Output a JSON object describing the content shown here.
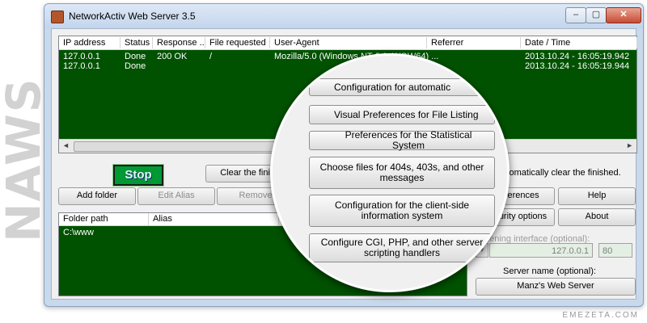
{
  "watermark": "NAWS",
  "credit": "EMEZETA.COM",
  "window": {
    "title": "NetworkActiv Web Server 3.5",
    "controls": {
      "minimize": "–",
      "maximize": "▢",
      "close": "✕"
    }
  },
  "log": {
    "columns": [
      "IP address",
      "Status",
      "Response ...",
      "File requested",
      "User-Agent",
      "Referrer",
      "Date / Time"
    ],
    "rows": [
      {
        "ip": "127.0.0.1",
        "status": "Done",
        "response": "200 OK",
        "file": "/",
        "agent": "Mozilla/5.0 (Windows NT 6.1; WOW64) ...",
        "referrer": "",
        "datetime": "2013.10.24 - 16:05:19.942"
      },
      {
        "ip": "127.0.0.1",
        "status": "Done",
        "response": "",
        "file": "",
        "agent": "",
        "referrer": "",
        "datetime": "2013.10.24 - 16:05:19.944"
      }
    ],
    "scroll_grip": "III"
  },
  "controls": {
    "stop": "Stop",
    "clear_finished": "Clear the finished",
    "auto_clear": "Automatically clear the finished.",
    "add_folder": "Add folder",
    "edit_alias": "Edit Alias",
    "remove": "Remove",
    "preferences": "Preferences",
    "help": "Help",
    "security_options": "Security options",
    "about": "About"
  },
  "folders": {
    "columns": [
      "Folder path",
      "Alias"
    ],
    "rows": [
      {
        "path": "C:\\www",
        "alias": ""
      }
    ]
  },
  "listening": {
    "label": "Listening interface (optional):",
    "ip": "127.0.0.1",
    "port": "80"
  },
  "server_name": {
    "label": "Server name (optional):",
    "value": "Manz's Web Server"
  },
  "magnifier": {
    "items": [
      "Configuration for automatic",
      "Visual Preferences for File Listing",
      "Preferences for the Statistical System",
      "Choose files for 404s, 403s, and other messages",
      "Configuration for the client-side information system",
      "Configure CGI, PHP, and other server scripting handlers"
    ]
  }
}
